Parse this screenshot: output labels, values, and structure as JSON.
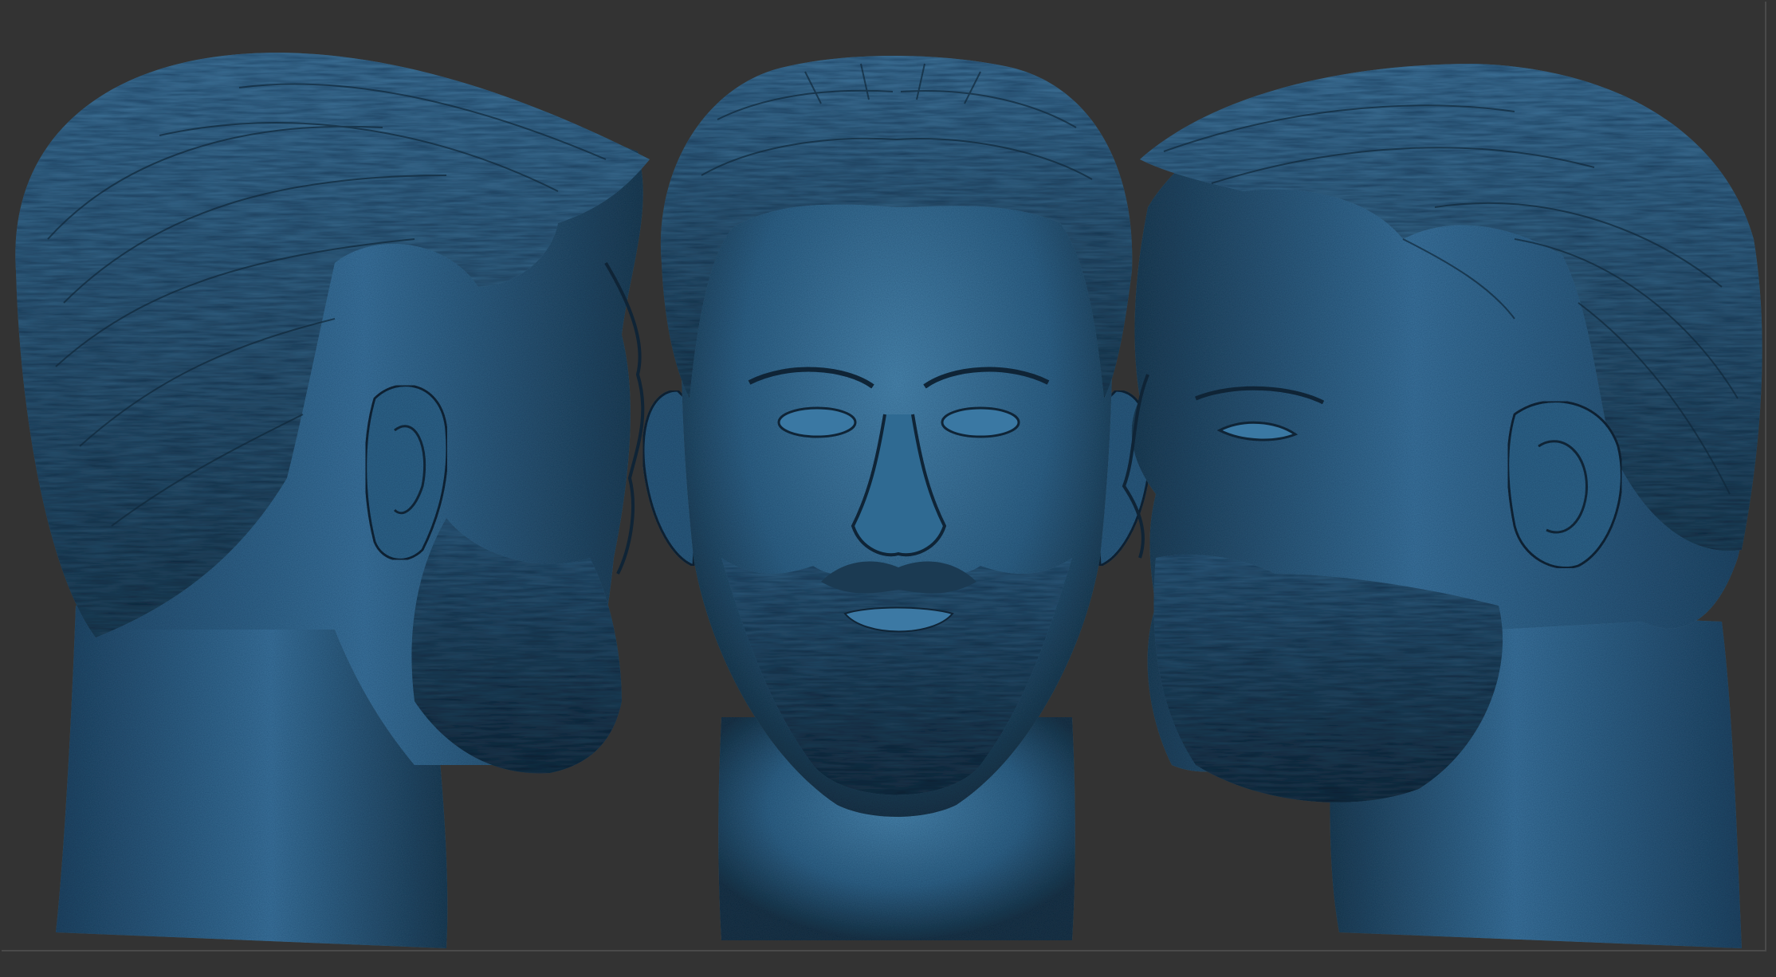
{
  "viewport": {
    "background_color": "#333333",
    "frame_color": "#4a4a4a"
  },
  "model": {
    "material_base_color": "#2a5a7d",
    "material_highlight_color": "#4f8fb8",
    "material_shadow_color": "#0f2436",
    "views": [
      "left-profile",
      "front",
      "right-profile"
    ]
  }
}
